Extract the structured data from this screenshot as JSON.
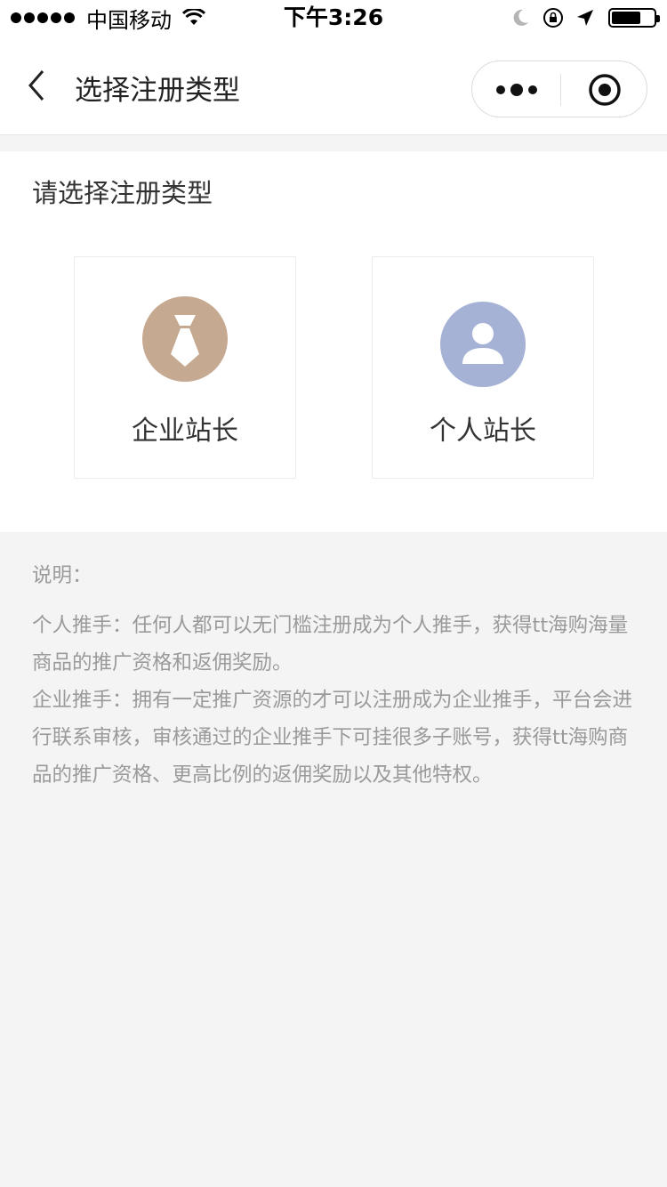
{
  "status_bar": {
    "carrier": "中国移动",
    "time": "下午3:26",
    "battery_level": 0.7
  },
  "nav": {
    "title": "选择注册类型",
    "icons": [
      "back-chevron-icon",
      "more-dots-icon",
      "close-target-icon"
    ]
  },
  "main": {
    "prompt": "请选择注册类型",
    "options": [
      {
        "label": "企业站长",
        "icon": "necktie-icon",
        "color": "#c6a991"
      },
      {
        "label": "个人站长",
        "icon": "person-icon",
        "color": "#a6b2d5"
      }
    ]
  },
  "description": {
    "heading": "说明：",
    "personal": "个人推手：任何人都可以无门槛注册成为个人推手，获得tt海购海量商品的推广资格和返佣奖励。",
    "enterprise": "企业推手：拥有一定推广资源的才可以注册成为企业推手，平台会进行联系审核，审核通过的企业推手下可挂很多子账号，获得tt海购商品的推广资格、更高比例的返佣奖励以及其他特权。"
  }
}
